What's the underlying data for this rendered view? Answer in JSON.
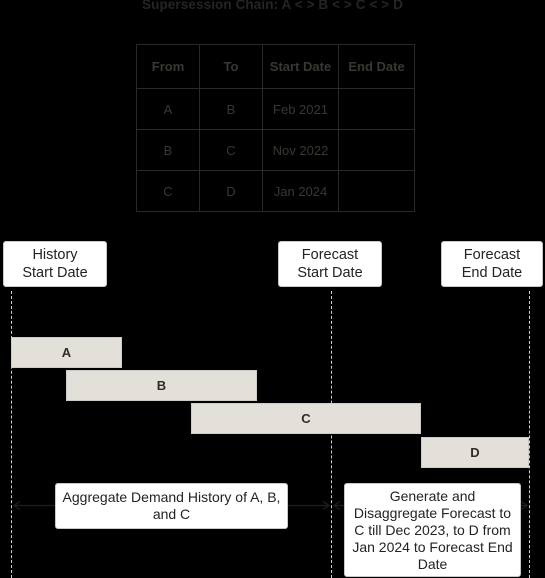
{
  "title": "Supersession Chain: A < > B < > C < > D",
  "table": {
    "headers": [
      "From",
      "To",
      "Start Date",
      "End Date"
    ],
    "rows": [
      {
        "from": "A",
        "to": "B",
        "start_date": "Feb 2021",
        "end_date": ""
      },
      {
        "from": "B",
        "to": "C",
        "start_date": "Nov 2022",
        "end_date": ""
      },
      {
        "from": "C",
        "to": "D",
        "start_date": "Jan 2024",
        "end_date": ""
      }
    ]
  },
  "milestones": {
    "history_start": "History\nStart Date",
    "history_start_line1": "History",
    "history_start_line2": "Start Date",
    "forecast_start_line1": "Forecast",
    "forecast_start_line2": "Start Date",
    "forecast_end_line1": "Forecast",
    "forecast_end_line2": "End Date"
  },
  "bars": [
    {
      "label": "A"
    },
    {
      "label": "B"
    },
    {
      "label": "C"
    },
    {
      "label": "D"
    }
  ],
  "descriptions": {
    "history": "Aggregate Demand History of A, B, and C",
    "forecast": "Generate and Disaggregate Forecast to C till Dec 2023, to D from Jan 2024 to Forecast End Date"
  },
  "colors": {
    "background": "#000000",
    "bar_fill": "#e3e0da",
    "bar_border": "#cfccc6",
    "box_fill": "#ffffff",
    "box_border": "#c9c9c9",
    "guide_line": "#cfcfcf",
    "text": "#232323",
    "table_border": "#2b2926",
    "table_text": "#3a3733"
  }
}
